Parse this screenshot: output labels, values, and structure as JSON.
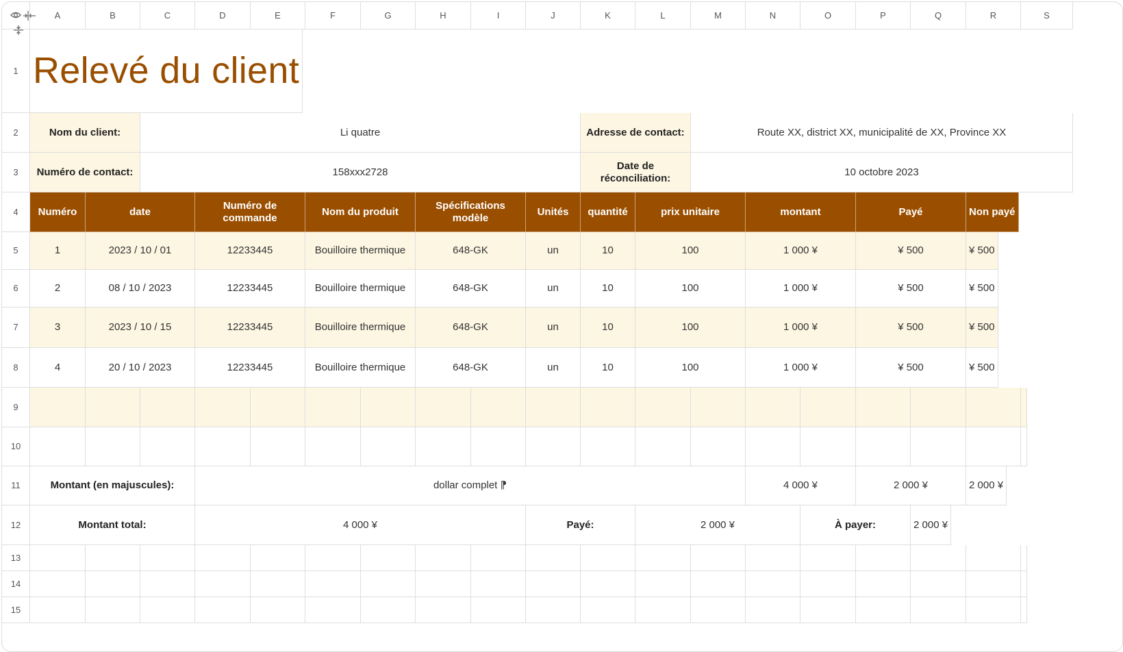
{
  "columns": [
    "A",
    "B",
    "C",
    "D",
    "E",
    "F",
    "G",
    "H",
    "I",
    "J",
    "K",
    "L",
    "M",
    "N",
    "O",
    "P",
    "Q",
    "R",
    "S"
  ],
  "rows": [
    "1",
    "2",
    "3",
    "4",
    "5",
    "6",
    "7",
    "8",
    "9",
    "10",
    "11",
    "12",
    "13",
    "14",
    "15"
  ],
  "title": "Relevé du client",
  "info": {
    "client_label": "Nom du client:",
    "client_value": "Li quatre",
    "address_label": "Adresse de contact:",
    "address_value": "Route XX, district XX, municipalité de XX, Province XX",
    "phone_label": "Numéro de contact:",
    "phone_value": "158xxx2728",
    "date_label": "Date de réconciliation:",
    "date_value": "10 octobre 2023"
  },
  "table_headers": [
    "Numéro",
    "date",
    "Numéro de commande",
    "Nom du produit",
    "Spécifications modèle",
    "Unités",
    "quantité",
    "prix unitaire",
    "montant",
    "Payé",
    "Non payé"
  ],
  "table_rows": [
    [
      "1",
      "2023 / 10 / 01",
      "12233445",
      "Bouilloire thermique",
      "648-GK",
      "un",
      "10",
      "100",
      "1 000 ¥",
      "¥ 500",
      "¥ 500"
    ],
    [
      "2",
      "08 / 10 / 2023",
      "12233445",
      "Bouilloire thermique",
      "648-GK",
      "un",
      "10",
      "100",
      "1 000 ¥",
      "¥ 500",
      "¥ 500"
    ],
    [
      "3",
      "2023 / 10 / 15",
      "12233445",
      "Bouilloire thermique",
      "648-GK",
      "un",
      "10",
      "100",
      "1 000 ¥",
      "¥ 500",
      "¥ 500"
    ],
    [
      "4",
      "20 / 10 / 2023",
      "12233445",
      "Bouilloire thermique",
      "648-GK",
      "un",
      "10",
      "100",
      "1 000 ¥",
      "¥ 500",
      "¥ 500"
    ]
  ],
  "words": {
    "label": "Montant (en majuscules):",
    "value": "dollar complet ⁋",
    "montant": "4 000 ¥",
    "paye": "2 000 ¥",
    "non_paye": "2 000 ¥"
  },
  "totals": {
    "total_label": "Montant total:",
    "total_value": "4 000 ¥",
    "paid_label": "Payé:",
    "paid_value": "2 000 ¥",
    "due_label": "À payer:",
    "due_value": "2 000 ¥"
  },
  "colors": {
    "accent": "#9a4f00",
    "band": "#fdf6e3",
    "grid": "#dedede"
  },
  "icons": [
    "eye-icon",
    "column-resize-icon",
    "row-resize-icon"
  ]
}
